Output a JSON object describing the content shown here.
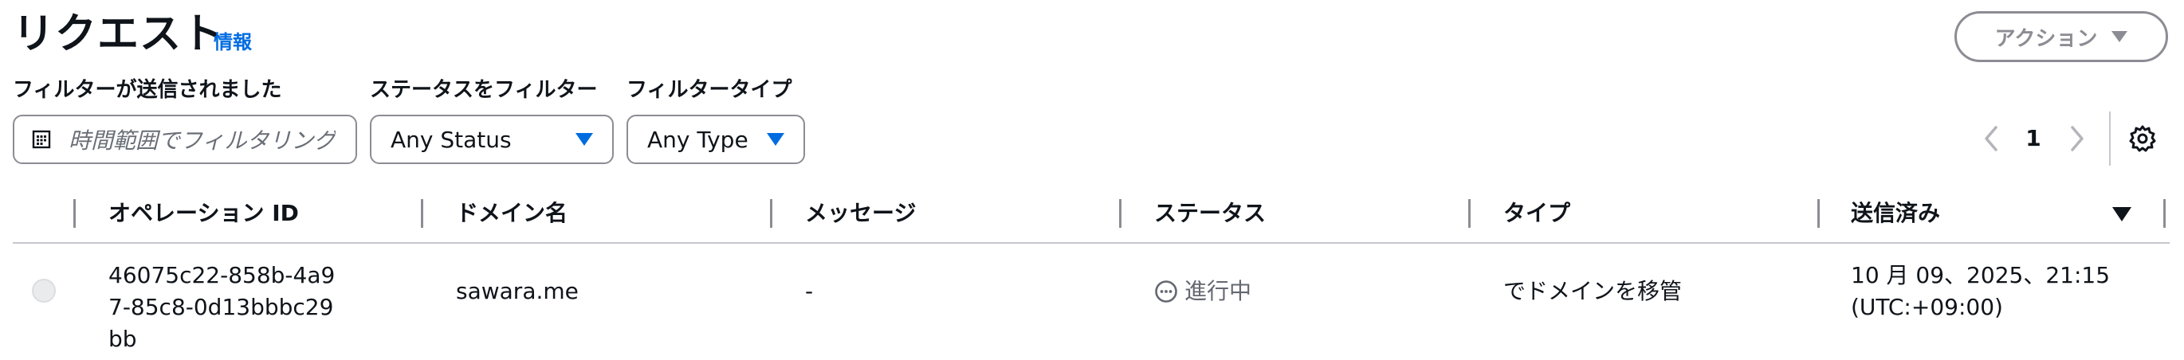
{
  "header": {
    "title": "リクエスト",
    "info_link": "情報",
    "actions_label": "アクション"
  },
  "filters": {
    "date": {
      "label": "フィルターが送信されました",
      "placeholder": "時間範囲でフィルタリング",
      "icon": "calendar-icon"
    },
    "status": {
      "label": "ステータスをフィルター",
      "value": "Any Status"
    },
    "type": {
      "label": "フィルタータイプ",
      "value": "Any Type"
    }
  },
  "pagination": {
    "current_page": "1"
  },
  "table": {
    "columns": [
      "オペレーション ID",
      "ドメイン名",
      "メッセージ",
      "ステータス",
      "タイプ",
      "送信済み"
    ],
    "sort_column": "送信済み",
    "rows": [
      {
        "operation_id": "46075c22-858b-4a97-85c8-0d13bbbc29bb",
        "domain": "sawara.me",
        "message": "-",
        "status": "進行中",
        "type": "でドメインを移管",
        "sent": "10 月 09、2025、21:15 (UTC:+09:00)"
      }
    ]
  },
  "colors": {
    "accent": "#006ce0",
    "border": "#8c8c94",
    "divider": "#c6c6cd",
    "status_pending": "#656871"
  }
}
